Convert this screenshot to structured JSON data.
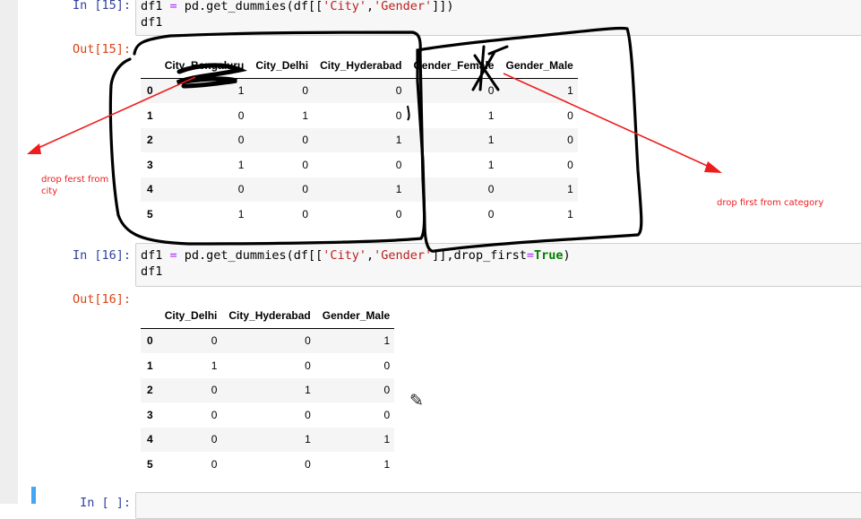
{
  "cell15": {
    "in_prompt": "In [15]:",
    "out_prompt": "Out[15]:",
    "code_line1": {
      "p1": "df1 ",
      "eq": "=",
      "p2": " pd.get_dummies(df[[",
      "s1": "'City'",
      "c": ",",
      "s2": "'Gender'",
      "p3": "]])"
    },
    "code_line2": "df1",
    "table": {
      "columns": [
        "",
        "City_Bengaluru",
        "City_Delhi",
        "City_Hyderabad",
        "Gender_Female",
        "Gender_Male"
      ],
      "rows": [
        {
          "index": "0",
          "values": [
            "1",
            "0",
            "0",
            "0",
            "1"
          ]
        },
        {
          "index": "1",
          "values": [
            "0",
            "1",
            "0",
            "1",
            "0"
          ]
        },
        {
          "index": "2",
          "values": [
            "0",
            "0",
            "1",
            "1",
            "0"
          ]
        },
        {
          "index": "3",
          "values": [
            "1",
            "0",
            "0",
            "1",
            "0"
          ]
        },
        {
          "index": "4",
          "values": [
            "0",
            "0",
            "1",
            "0",
            "1"
          ]
        },
        {
          "index": "5",
          "values": [
            "1",
            "0",
            "0",
            "0",
            "1"
          ]
        }
      ]
    }
  },
  "cell16": {
    "in_prompt": "In [16]:",
    "out_prompt": "Out[16]:",
    "code_line1": {
      "p1": "df1 ",
      "eq": "=",
      "p2": " pd.get_dummies(df[[",
      "s1": "'City'",
      "c": ",",
      "s2": "'Gender'",
      "p3": "]],drop_first",
      "eq2": "=",
      "kw": "True",
      "p4": ")"
    },
    "code_line2": "df1",
    "table": {
      "columns": [
        "",
        "City_Delhi",
        "City_Hyderabad",
        "Gender_Male"
      ],
      "rows": [
        {
          "index": "0",
          "values": [
            "0",
            "0",
            "1"
          ]
        },
        {
          "index": "1",
          "values": [
            "1",
            "0",
            "0"
          ]
        },
        {
          "index": "2",
          "values": [
            "0",
            "1",
            "0"
          ]
        },
        {
          "index": "3",
          "values": [
            "0",
            "0",
            "0"
          ]
        },
        {
          "index": "4",
          "values": [
            "0",
            "1",
            "1"
          ]
        },
        {
          "index": "5",
          "values": [
            "0",
            "0",
            "1"
          ]
        }
      ]
    }
  },
  "cell17": {
    "in_prompt": "In [ ]:"
  },
  "annotations": {
    "left": [
      "drop ferst from",
      "city"
    ],
    "right": "drop first from category"
  },
  "colors": {
    "annotation": "#ee1c1c",
    "ink": "#000000",
    "active_cell": "#42a5f5"
  }
}
